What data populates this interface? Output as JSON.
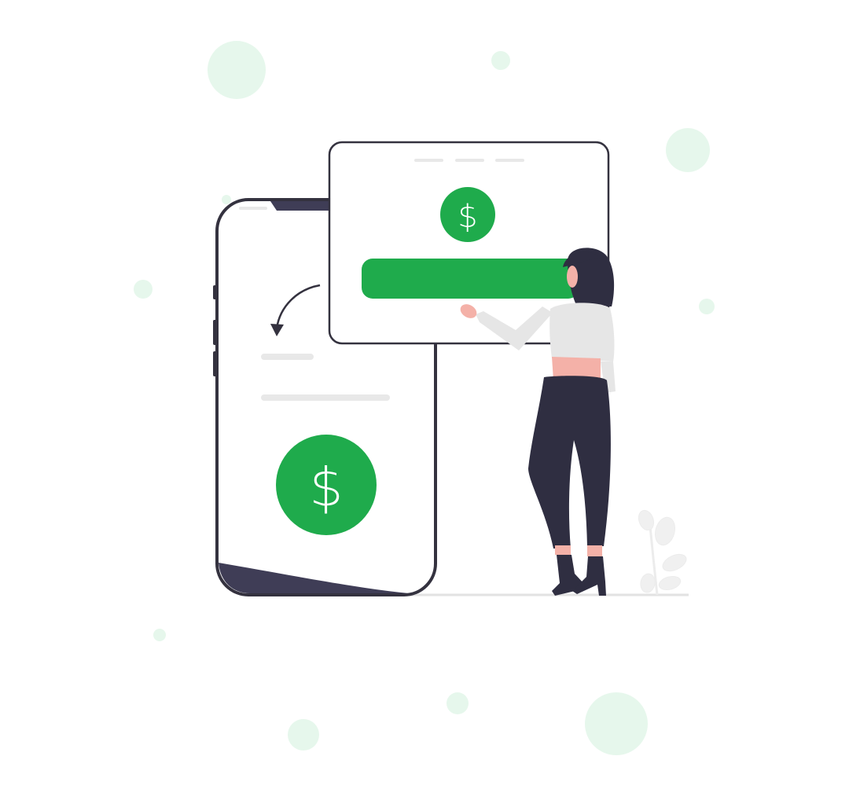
{
  "illustration": {
    "phone_symbol": "$",
    "card_symbol": "$"
  },
  "colors": {
    "accent": "#1fab4c",
    "bubble": "#e6f7ec",
    "ink": "#34323f",
    "placeholder": "#e8e8e8",
    "skin": "#f4b1a8",
    "shirt": "#e6e6e6"
  },
  "icons": [
    "dollar-icon",
    "curved-arrow-icon",
    "plant-icon"
  ]
}
